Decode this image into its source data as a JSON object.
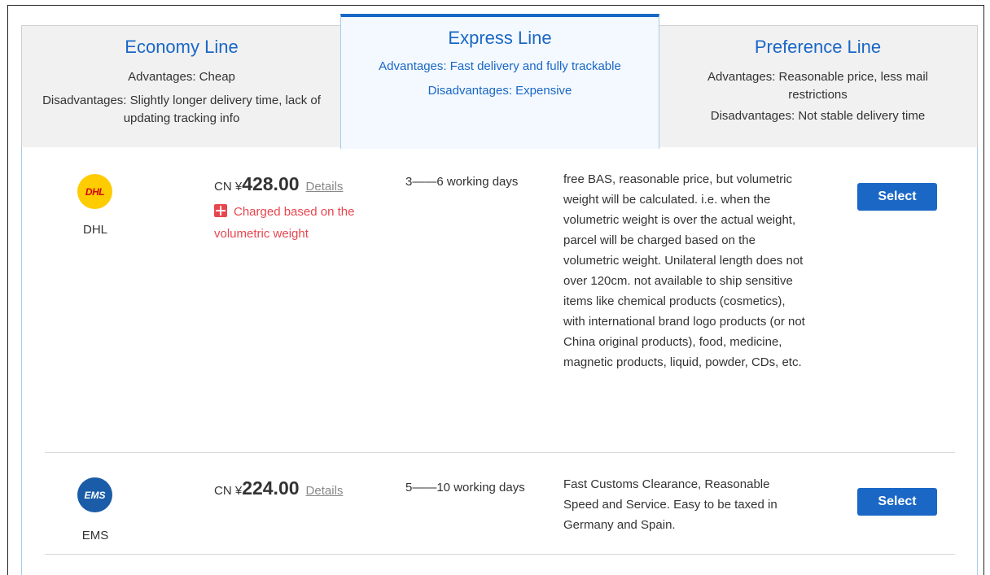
{
  "tabs": [
    {
      "title": "Economy Line",
      "advantages": "Advantages: Cheap",
      "disadvantages": "Disadvantages: Slightly longer delivery time, lack of updating tracking info"
    },
    {
      "title": "Express Line",
      "advantages": "Advantages: Fast delivery and fully trackable",
      "disadvantages": "Disadvantages: Expensive",
      "active": true
    },
    {
      "title": "Preference Line",
      "advantages": "Advantages: Reasonable price, less mail restrictions",
      "disadvantages": "Disadvantages: Not stable delivery time"
    }
  ],
  "carriers": [
    {
      "logo_text": "DHL",
      "name": "DHL",
      "currency": "CN ¥",
      "price": "428.00",
      "details_label": "Details",
      "warning": "Charged based on the volumetric weight",
      "delivery_time": "3——6 working days",
      "description": "free BAS, reasonable price, but volumetric weight will be calculated. i.e. when the volumetric weight is over the actual weight, parcel will be charged based on the volumetric weight. Unilateral length does not over 120cm. not available to ship sensitive items like chemical products (cosmetics), with international brand logo products (or not China original products), food, medicine, magnetic products, liquid, powder, CDs, etc.",
      "select_label": "Select"
    },
    {
      "logo_text": "EMS",
      "name": "EMS",
      "currency": "CN ¥",
      "price": "224.00",
      "details_label": "Details",
      "delivery_time": "5——10 working days",
      "description": "Fast Customs Clearance, Reasonable Speed and Service. Easy to be taxed in Germany and Spain.",
      "select_label": "Select"
    }
  ],
  "colors": {
    "accent": "#1a67c6",
    "warning": "#e8464f",
    "active_tab_bg": "#f3f9ff",
    "inactive_tab_bg": "#f1f1f1"
  }
}
